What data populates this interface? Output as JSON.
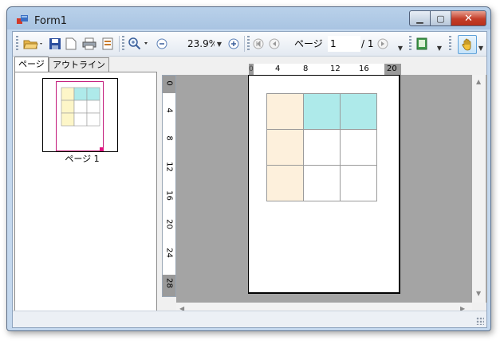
{
  "window": {
    "title": "Form1"
  },
  "toolbar": {
    "zoom_value": "23.9%",
    "page_label": "ページ",
    "page_input": "1",
    "page_total": "/ 1"
  },
  "tabs": [
    {
      "label": "ページ"
    },
    {
      "label": "アウトライン"
    }
  ],
  "thumbnail": {
    "label": "ページ 1"
  },
  "ruler": {
    "horizontal_ticks": [
      "0",
      "4",
      "8",
      "12",
      "16",
      "20"
    ],
    "vertical_ticks": [
      "0",
      "4",
      "8",
      "12",
      "16",
      "20",
      "24",
      "28"
    ]
  },
  "grid": {
    "rows": [
      [
        "peach",
        "cyan",
        "cyan"
      ],
      [
        "peach",
        "white",
        "white"
      ],
      [
        "peach",
        "white",
        "white"
      ]
    ]
  },
  "colors": {
    "peach": "#fdf0dc",
    "cyan": "#aeeaea",
    "white": "#ffffff"
  }
}
